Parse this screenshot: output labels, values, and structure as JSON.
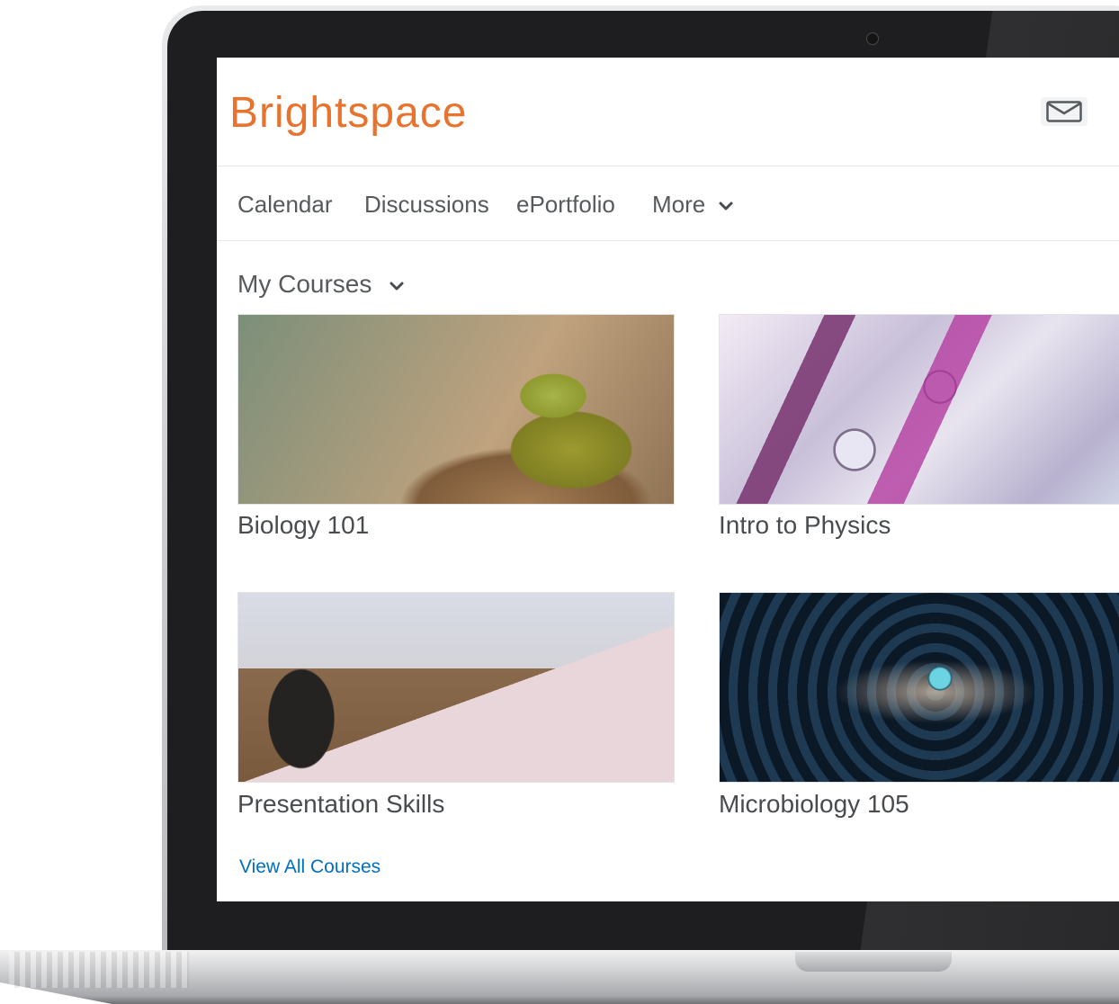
{
  "app": {
    "logo_text": "Brightspace",
    "brand_color": "#e8732f",
    "link_color": "#006fbf"
  },
  "header": {
    "icons": [
      "mail-icon"
    ]
  },
  "nav": {
    "items": [
      {
        "label": "Calendar"
      },
      {
        "label": "Discussions"
      },
      {
        "label": "ePortfolio"
      },
      {
        "label": "More",
        "icon": "chevron-down-icon"
      }
    ]
  },
  "courses": {
    "heading": "My Courses",
    "heading_icon": "chevron-down-icon",
    "tiles": [
      {
        "title": "Biology 101",
        "image": "frog-photo"
      },
      {
        "title": "Intro to Physics",
        "image": "physics-instruments-photo"
      },
      {
        "title": "Presentation Skills",
        "image": "laptop-desk-photo"
      },
      {
        "title": "Microbiology 105",
        "image": "blue-spheres-photo"
      }
    ],
    "view_all": "View All Courses"
  }
}
